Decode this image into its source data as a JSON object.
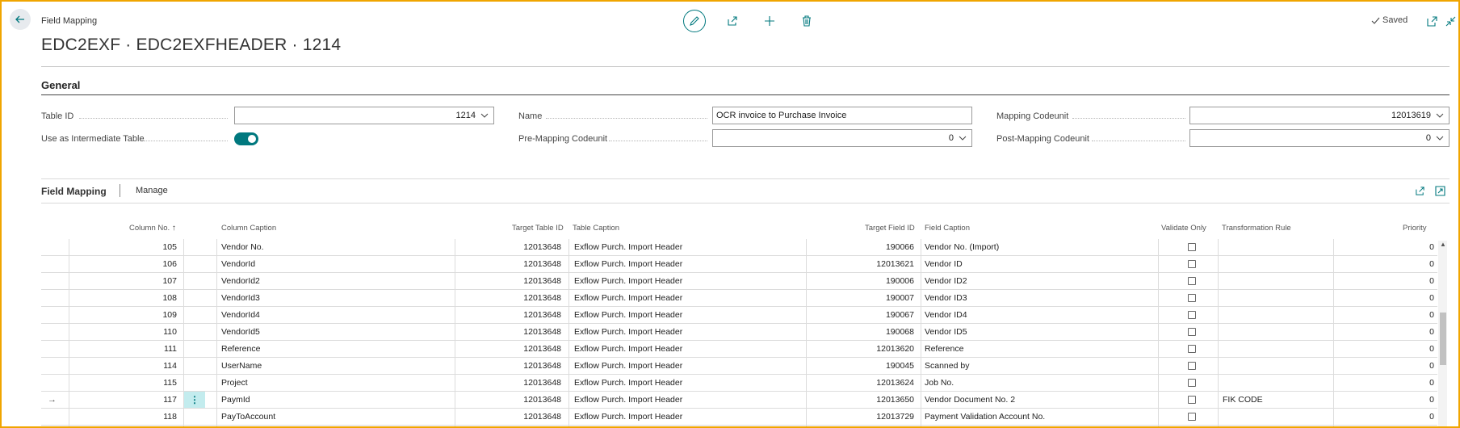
{
  "header": {
    "breadcrumb": "Field Mapping",
    "title": "EDC2EXF · EDC2EXFHEADER · 1214",
    "saved_label": "Saved"
  },
  "general": {
    "section_title": "General",
    "table_id_label": "Table ID",
    "table_id_value": "1214",
    "intermediate_label": "Use as Intermediate Table",
    "intermediate_value": true,
    "name_label": "Name",
    "name_value": "OCR invoice to Purchase Invoice",
    "pre_mapping_label": "Pre-Mapping Codeunit",
    "pre_mapping_value": "0",
    "mapping_label": "Mapping Codeunit",
    "mapping_value": "12013619",
    "post_mapping_label": "Post-Mapping Codeunit",
    "post_mapping_value": "0"
  },
  "part": {
    "title": "Field Mapping",
    "manage_label": "Manage"
  },
  "columns": {
    "col_no": "Column No.",
    "col_no_sort": "↑",
    "col_caption": "Column Caption",
    "target_table_id": "Target Table ID",
    "table_caption": "Table Caption",
    "target_field_id": "Target Field ID",
    "field_caption": "Field Caption",
    "validate_only": "Validate Only",
    "transformation_rule": "Transformation Rule",
    "priority": "Priority"
  },
  "rows": [
    {
      "no": "105",
      "caption": "Vendor No.",
      "table_id": "12013648",
      "table_caption": "Exflow Purch. Import Header",
      "field_id": "190066",
      "field_caption": "Vendor No. (Import)",
      "validate": false,
      "rule": "",
      "priority": "0",
      "selected": false
    },
    {
      "no": "106",
      "caption": "VendorId",
      "table_id": "12013648",
      "table_caption": "Exflow Purch. Import Header",
      "field_id": "12013621",
      "field_caption": "Vendor ID",
      "validate": false,
      "rule": "",
      "priority": "0",
      "selected": false
    },
    {
      "no": "107",
      "caption": "VendorId2",
      "table_id": "12013648",
      "table_caption": "Exflow Purch. Import Header",
      "field_id": "190006",
      "field_caption": "Vendor ID2",
      "validate": false,
      "rule": "",
      "priority": "0",
      "selected": false
    },
    {
      "no": "108",
      "caption": "VendorId3",
      "table_id": "12013648",
      "table_caption": "Exflow Purch. Import Header",
      "field_id": "190007",
      "field_caption": "Vendor ID3",
      "validate": false,
      "rule": "",
      "priority": "0",
      "selected": false
    },
    {
      "no": "109",
      "caption": "VendorId4",
      "table_id": "12013648",
      "table_caption": "Exflow Purch. Import Header",
      "field_id": "190067",
      "field_caption": "Vendor ID4",
      "validate": false,
      "rule": "",
      "priority": "0",
      "selected": false
    },
    {
      "no": "110",
      "caption": "VendorId5",
      "table_id": "12013648",
      "table_caption": "Exflow Purch. Import Header",
      "field_id": "190068",
      "field_caption": "Vendor ID5",
      "validate": false,
      "rule": "",
      "priority": "0",
      "selected": false
    },
    {
      "no": "111",
      "caption": "Reference",
      "table_id": "12013648",
      "table_caption": "Exflow Purch. Import Header",
      "field_id": "12013620",
      "field_caption": "Reference",
      "validate": false,
      "rule": "",
      "priority": "0",
      "selected": false
    },
    {
      "no": "114",
      "caption": "UserName",
      "table_id": "12013648",
      "table_caption": "Exflow Purch. Import Header",
      "field_id": "190045",
      "field_caption": "Scanned by",
      "validate": false,
      "rule": "",
      "priority": "0",
      "selected": false
    },
    {
      "no": "115",
      "caption": "Project",
      "table_id": "12013648",
      "table_caption": "Exflow Purch. Import Header",
      "field_id": "12013624",
      "field_caption": "Job No.",
      "validate": false,
      "rule": "",
      "priority": "0",
      "selected": false
    },
    {
      "no": "117",
      "caption": "PaymId",
      "table_id": "12013648",
      "table_caption": "Exflow Purch. Import Header",
      "field_id": "12013650",
      "field_caption": "Vendor Document No. 2",
      "validate": false,
      "rule": "FIK CODE",
      "priority": "0",
      "selected": true
    },
    {
      "no": "118",
      "caption": "PayToAccount",
      "table_id": "12013648",
      "table_caption": "Exflow Purch. Import Header",
      "field_id": "12013729",
      "field_caption": "Payment Validation Account No.",
      "validate": false,
      "rule": "",
      "priority": "0",
      "selected": false
    }
  ],
  "icons": {
    "back": "arrow-left-icon",
    "edit": "pencil-icon",
    "share": "share-icon",
    "new": "plus-icon",
    "delete": "trash-icon",
    "saved": "check-icon",
    "open_new": "open-in-new-window-icon",
    "collapse": "collapse-icon",
    "part_share": "share-icon",
    "part_expand": "expand-icon",
    "row_actions": "more-vertical-icon",
    "current_row": "arrow-right-icon"
  },
  "colors": {
    "accent": "#00787e",
    "frame": "#f0a500",
    "selected_cell": "#c3ecee"
  }
}
